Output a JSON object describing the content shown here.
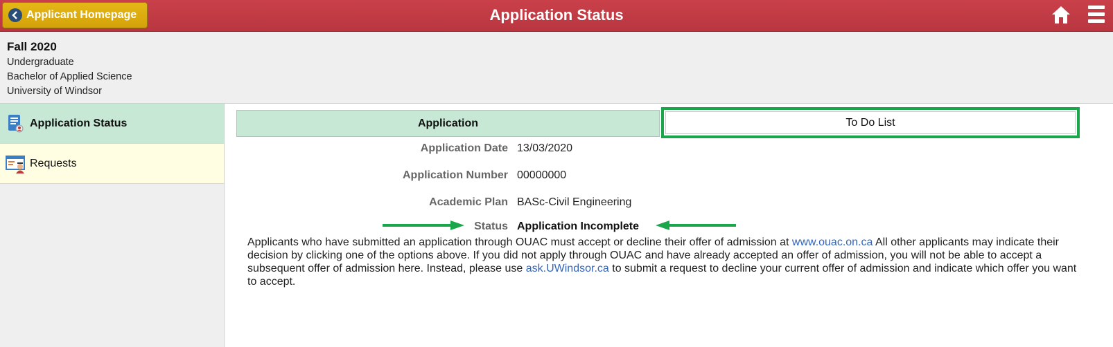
{
  "header": {
    "back_label": "Applicant Homepage",
    "title": "Application Status",
    "home_icon": "home-icon",
    "menu_icon": "hamburger-menu-icon"
  },
  "info": {
    "term": "Fall 2020",
    "career": "Undergraduate",
    "program": "Bachelor of Applied Science",
    "institution": "University of Windsor"
  },
  "sidebar": {
    "items": [
      {
        "label": "Application Status",
        "icon": "application-status-icon",
        "active": true
      },
      {
        "label": "Requests",
        "icon": "requests-icon",
        "active": false
      }
    ]
  },
  "tabs": {
    "application": "Application",
    "todo": "To Do List"
  },
  "fields": {
    "date_label": "Application Date",
    "date_value": "13/03/2020",
    "number_label": "Application Number",
    "number_value": "00000000",
    "plan_label": "Academic Plan",
    "plan_value": "BASc-Civil Engineering",
    "status_label": "Status",
    "status_value": "Application Incomplete"
  },
  "notice": {
    "part1": "Applicants who have submitted an application through OUAC must accept or decline their offer of admission at ",
    "link1": "www.ouac.on.ca",
    "part2": " All other applicants may indicate their decision by clicking one of the options above. If you did not apply through OUAC and have already accepted an offer of admission, you will not be able to accept a subsequent offer of admission here. Instead, please use ",
    "link2": "ask.UWindsor.ca",
    "part3": " to submit a request to decline your current offer of admission and indicate which offer you want to accept."
  },
  "colors": {
    "header_red": "#c9404a",
    "back_button_gold": "#e4b716",
    "active_tab_green": "#c8e8d6",
    "highlight_green": "#1aa64a",
    "link_blue": "#3366bb"
  }
}
